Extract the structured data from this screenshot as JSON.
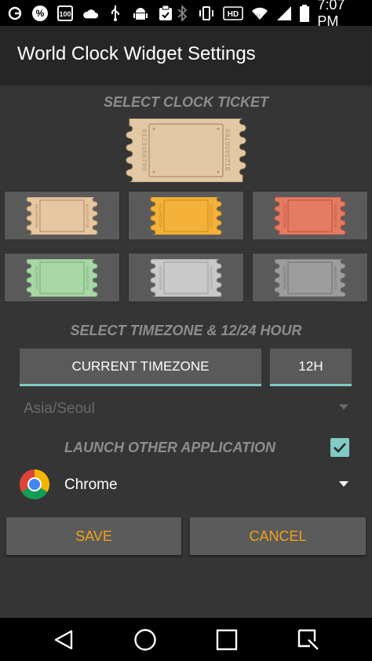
{
  "status_bar": {
    "time": "7:07 PM",
    "icons": [
      "lg-icon",
      "percent-icon",
      "hundred-icon",
      "cloud-icon",
      "usb-icon",
      "android-icon",
      "clipboard-icon",
      "bluetooth-icon",
      "vibrate-icon",
      "hd-icon",
      "wifi-icon",
      "signal-icon",
      "battery-icon"
    ],
    "hd_label": "HD",
    "hundred_label": "100"
  },
  "app_bar": {
    "title": "World Clock Widget Settings"
  },
  "clock_ticket": {
    "section_title": "SELECT CLOCK TICKET",
    "ticket_number": "0123456789",
    "selected": {
      "color": "#e2c9a6",
      "border": "#b8956a"
    },
    "options": [
      {
        "color": "#e6c7a2",
        "border": "#b38a62"
      },
      {
        "color": "#f4b23a",
        "border": "#c98a1a"
      },
      {
        "color": "#e57b63",
        "border": "#b5523c"
      },
      {
        "color": "#a8d8a5",
        "border": "#7aa877"
      },
      {
        "color": "#c9c9c9",
        "border": "#9a9a9a"
      },
      {
        "color": "#9d9d9d",
        "border": "#707070"
      }
    ]
  },
  "timezone": {
    "section_title": "SELECT TIMEZONE & 12/24 HOUR",
    "current_button": "CURRENT TIMEZONE",
    "hour_button": "12H",
    "selected_value": "Asia/Seoul"
  },
  "launch": {
    "label": "LAUNCH OTHER APPLICATION",
    "checked": true,
    "app_name": "Chrome"
  },
  "actions": {
    "save": "SAVE",
    "cancel": "CANCEL"
  },
  "colors": {
    "accent": "#80cbc4",
    "action_text": "#f0a11a",
    "section_text": "#8d8d8d"
  }
}
